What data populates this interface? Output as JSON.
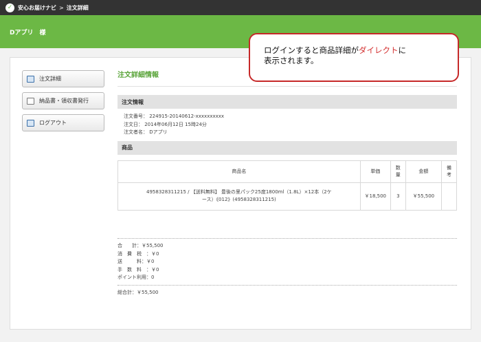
{
  "topbar": {
    "logo": "✓",
    "crumb_home": "安心お届けナビ",
    "separator": ">",
    "crumb_current": "注文詳細"
  },
  "header": {
    "user": "Dアプリ　様"
  },
  "menu": [
    {
      "label": "注文詳細",
      "icon": "document-icon"
    },
    {
      "label": "納品書・領収書発行",
      "icon": "receipt-icon"
    },
    {
      "label": "ログアウト",
      "icon": "logout-icon"
    }
  ],
  "main": {
    "title": "注文詳細情報",
    "order_section": "注文情報",
    "order_number": "注文番号： 224915-20140612-xxxxxxxxxx",
    "order_date": "注文日： 2014年06月12日 15時24分",
    "orderer": "注文者名： Dアプリ",
    "items_section": "商品",
    "columns": {
      "name": "商品名",
      "unit_price": "単価",
      "qty": "数量",
      "amount": "金額",
      "note": "備考"
    },
    "items": [
      {
        "name_line1": "4958328311215 / 【送料無料】 豊後の里パック25度1800ml（1.8L）×12本（2ケ",
        "name_line2": "ース）《012》(4958328311215)",
        "unit_price": "￥18,500",
        "qty": "3",
        "amount": "￥55,500",
        "note": ""
      }
    ]
  },
  "totals": {
    "subtotal": "合　　計：￥55,500",
    "tax": "消　費　税　：￥0",
    "shipping": "送　　　料：￥0",
    "fee": "手　数　料　：￥0",
    "points": "ポイント利用：0",
    "grand_total": "総合計：￥55,500"
  },
  "callout": {
    "text_before": "ログインすると商品詳細が",
    "text_highlight": "ダイレクト",
    "text_after": "に",
    "line2": "表示されます。"
  },
  "colors": {
    "green": "#6cb845",
    "topbar": "#333333",
    "accent_red": "#c62828"
  }
}
